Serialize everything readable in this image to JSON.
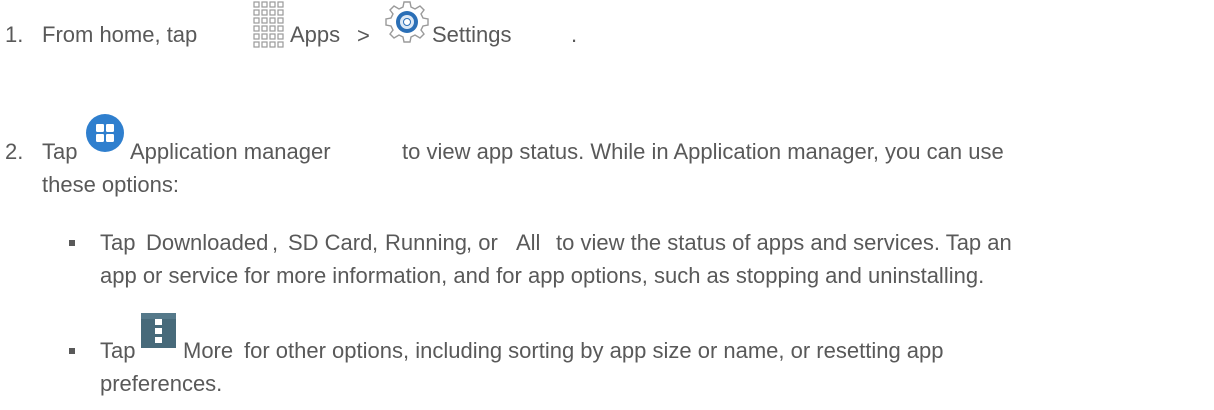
{
  "steps": [
    {
      "number": "1.",
      "before_apps": "From home, tap",
      "apps_label": "Apps",
      "separator": ">",
      "settings_label": "Settings",
      "end": "."
    },
    {
      "number": "2.",
      "tap": "Tap",
      "app_manager_label": "Application manager",
      "line1_rest": "to view app status. While in Application manager, you can use",
      "line2": "these options:"
    }
  ],
  "bullets": [
    {
      "line1": {
        "tap": "Tap",
        "downloaded": "Downloaded",
        "comma1": ",",
        "sd_card": "SD Card",
        "comma2": ",",
        "running": "Running",
        "or": ", or",
        "all": "All",
        "rest": "to view the status of apps and services. Tap an"
      },
      "line2": "app or service for more information, and for app options, such as stopping and uninstalling."
    },
    {
      "line1": {
        "tap": "Tap",
        "more_label": "More",
        "rest": "for other options, including sorting by app size or name, or resetting app"
      },
      "line2": "preferences."
    }
  ],
  "icons": {
    "apps": "apps-grid-icon",
    "settings": "settings-gear-icon",
    "application_manager": "application-manager-icon",
    "more": "more-options-icon"
  },
  "colors": {
    "text": "#595959",
    "grid_icon": "#9a9a9a",
    "gear_blue": "#2b6fb6",
    "app_manager_blue": "#2f7fce",
    "more_icon": "#476a7a"
  }
}
